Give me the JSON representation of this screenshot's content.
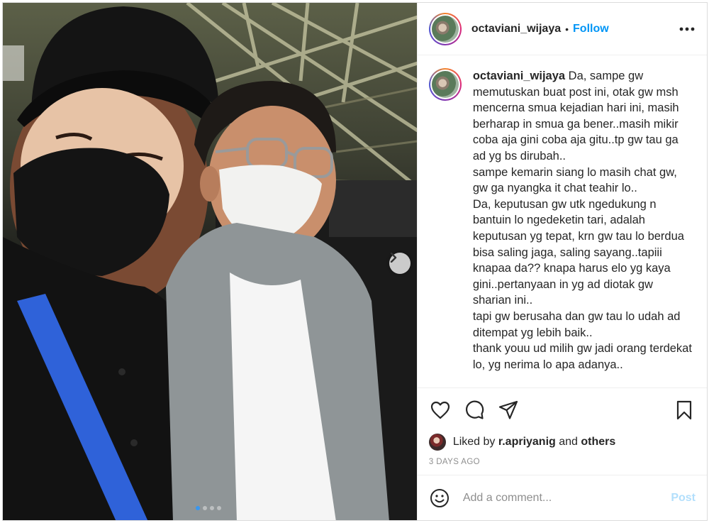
{
  "post": {
    "username": "octaviani_wijaya",
    "separator": "•",
    "follow_label": "Follow",
    "more_icon": "more-horizontal-icon"
  },
  "caption": {
    "username": "octaviani_wijaya",
    "text": "Da, sampe gw memutuskan buat post ini, otak gw msh mencerna smua kejadian hari ini, masih berharap in smua ga bener..masih mikir coba aja gini coba aja gitu..tp gw tau ga ad yg bs dirubah..\nsampe kemarin siang lo masih chat gw, gw ga nyangka it chat teahir lo..\nDa, keputusan gw utk ngedukung n bantuin lo ngedeketin tari, adalah keputusan yg tepat, krn gw tau lo berdua bisa saling jaga, saling sayang..tapiii knapaa da?? knapa harus elo yg kaya gini..pertanyaan in yg ad diotak gw sharian ini..\ntapi gw berusaha dan gw tau lo udah ad ditempat yg lebih baik..\nthank youu ud milih gw jadi orang terdekat lo, yg nerima lo apa adanya.."
  },
  "actions": {
    "like_icon": "heart-icon",
    "comment_icon": "comment-icon",
    "share_icon": "paper-plane-icon",
    "save_icon": "bookmark-icon"
  },
  "likes": {
    "prefix": "Liked by ",
    "user": "r.apriyanig",
    "middle": " and ",
    "others": "others"
  },
  "timestamp": "3 DAYS AGO",
  "comment_box": {
    "placeholder": "Add a comment...",
    "post_label": "Post",
    "emoji_icon": "smiley-icon"
  },
  "carousel": {
    "total_slides": 4,
    "current_slide": 1
  },
  "colors": {
    "follow_blue": "#0095f6",
    "post_disabled": "#b2dffc",
    "carousel_active": "#3897f0"
  }
}
